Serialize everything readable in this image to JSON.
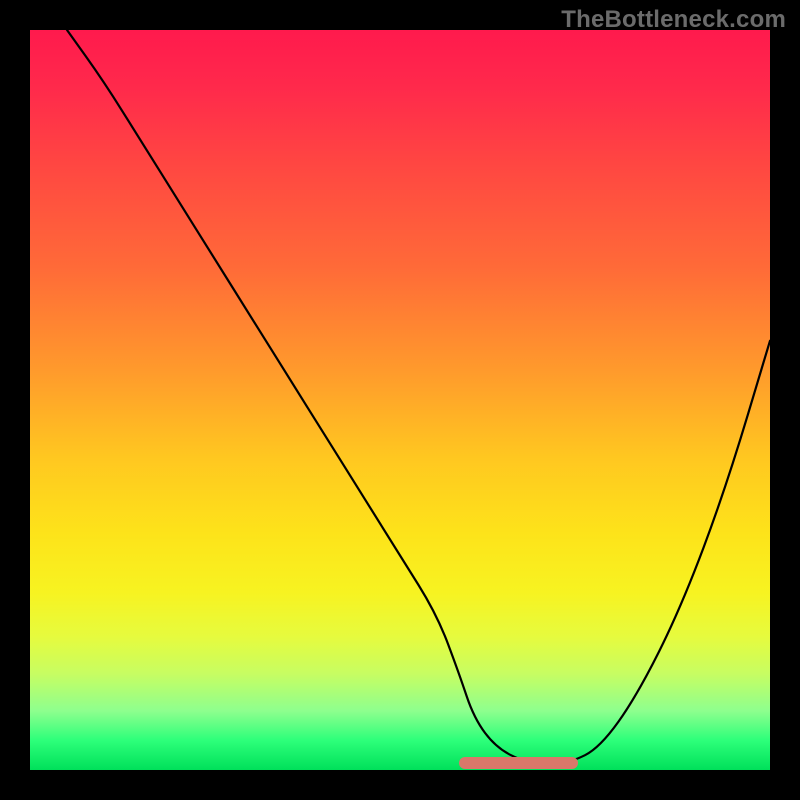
{
  "watermark": "TheBottleneck.com",
  "colors": {
    "frame": "#000000",
    "curve": "#000000",
    "segment": "#d9776a",
    "watermark": "#6b6b6b"
  },
  "chart_data": {
    "type": "line",
    "title": "",
    "xlabel": "",
    "ylabel": "",
    "xlim": [
      0,
      100
    ],
    "ylim": [
      0,
      100
    ],
    "grid": false,
    "legend": false,
    "series": [
      {
        "name": "curve",
        "x": [
          5,
          10,
          15,
          20,
          25,
          30,
          35,
          40,
          45,
          50,
          55,
          58,
          60,
          63,
          67,
          70,
          73,
          77,
          82,
          88,
          94,
          100
        ],
        "y": [
          100,
          93,
          85,
          77,
          69,
          61,
          53,
          45,
          37,
          29,
          21,
          13,
          7,
          3,
          1,
          1,
          1,
          3,
          10,
          22,
          38,
          58
        ]
      }
    ],
    "highlight_segment": {
      "x_start": 58,
      "x_end": 74,
      "y": 1
    },
    "gradient_stops": [
      {
        "pos": 0,
        "color": "#ff1a4d"
      },
      {
        "pos": 18,
        "color": "#ff4642"
      },
      {
        "pos": 46,
        "color": "#ff9a2c"
      },
      {
        "pos": 68,
        "color": "#fde31a"
      },
      {
        "pos": 87,
        "color": "#c7fd62"
      },
      {
        "pos": 100,
        "color": "#00e05a"
      }
    ]
  }
}
